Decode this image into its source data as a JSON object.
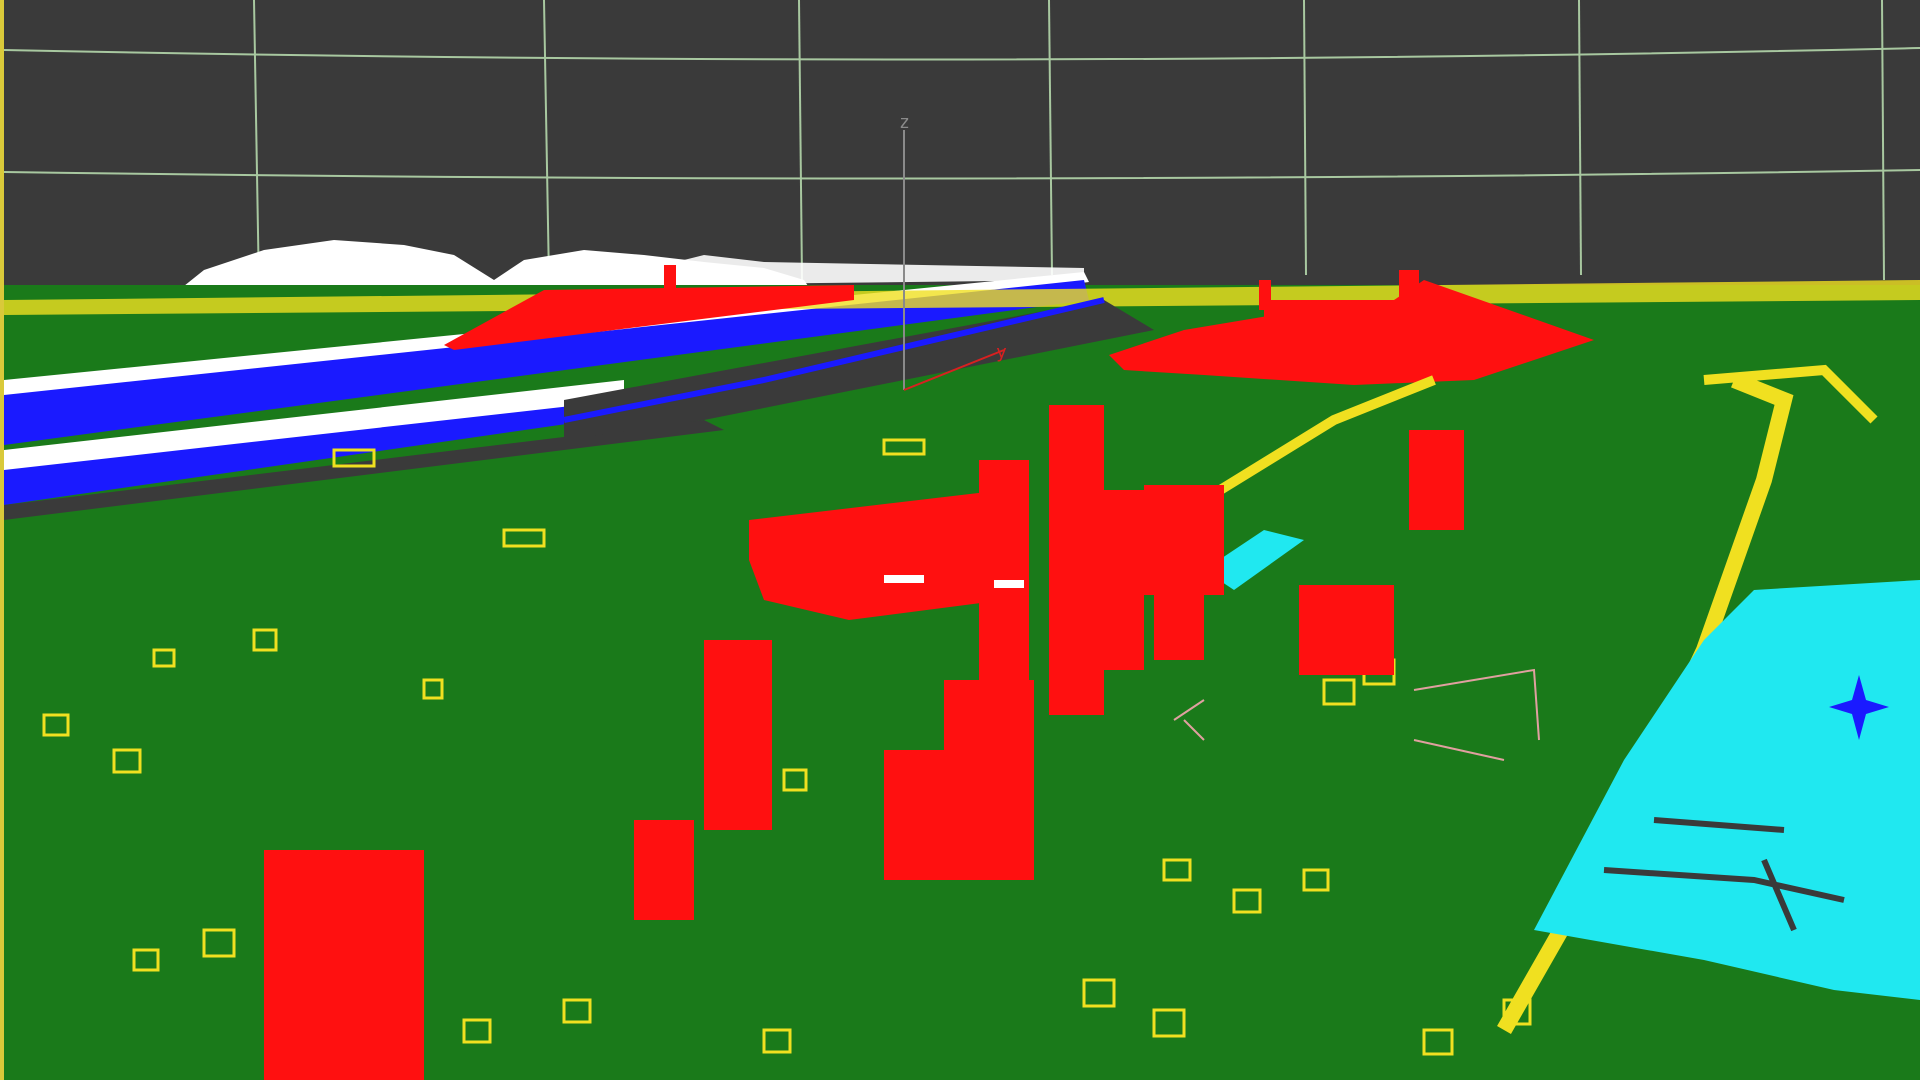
{
  "viewport": {
    "background": "#3a3a3a",
    "border_color": "#d9c93a",
    "grid_color": "#a8c8a0"
  },
  "gizmo": {
    "z_label": "z",
    "y_label": "y",
    "z_color": "#8a8a8a",
    "y_color": "#d82020"
  },
  "layers": [
    {
      "name": "terrain",
      "color": "#ffffff"
    },
    {
      "name": "roads",
      "color": "#1a1aff"
    },
    {
      "name": "river",
      "color": "#3a3a3a"
    },
    {
      "name": "vegetation",
      "color": "#1a7a1a"
    },
    {
      "name": "buildings-highlight",
      "color": "#ff1010"
    },
    {
      "name": "buildings-wire",
      "color": "#f0e020"
    },
    {
      "name": "water-area",
      "color": "#20e8f0"
    }
  ],
  "icons": {
    "compass": "compass-icon"
  }
}
